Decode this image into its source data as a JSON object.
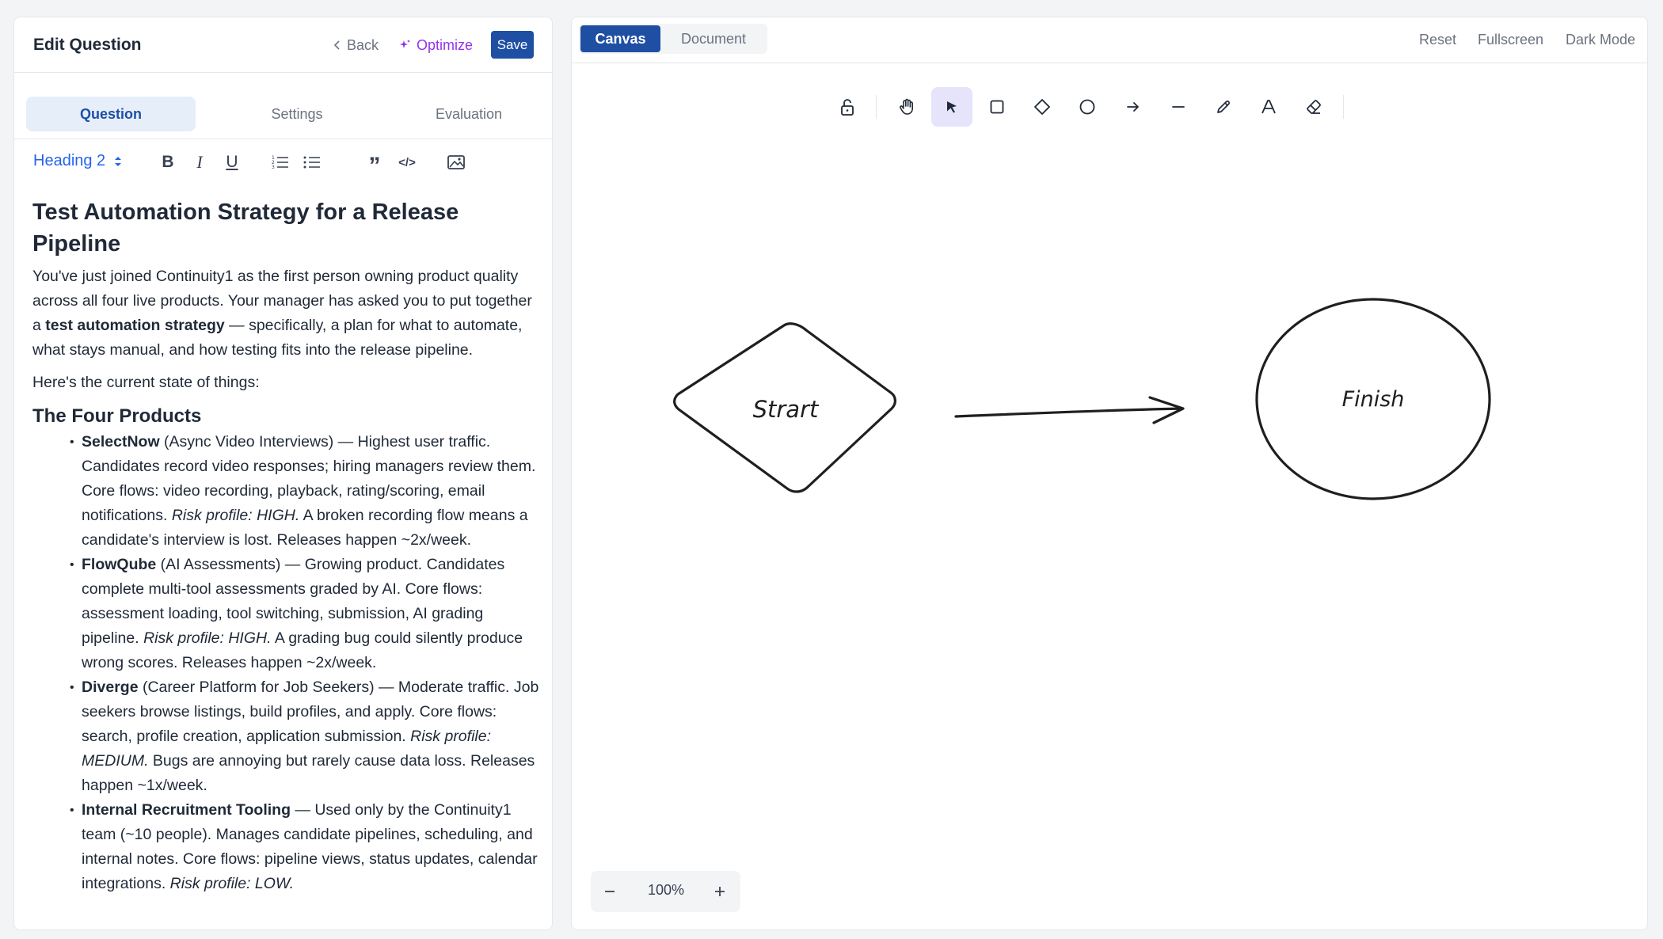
{
  "header": {
    "title": "Edit Question",
    "back_label": "Back",
    "optimize_label": "Optimize",
    "save_label": "Save"
  },
  "tabs": [
    {
      "label": "Question",
      "active": true
    },
    {
      "label": "Settings",
      "active": false
    },
    {
      "label": "Evaluation",
      "active": false
    }
  ],
  "editor_toolbar": {
    "heading_select": "Heading 2",
    "buttons": [
      "bold-icon",
      "italic-icon",
      "underline-icon",
      "ordered-list-icon",
      "bullet-list-icon",
      "quote-icon",
      "code-icon",
      "image-icon"
    ]
  },
  "content": {
    "title": "Test Automation Strategy for a Release Pipeline",
    "intro_1": "You've just joined Continuity1 as the first person owning product quality across all four live products. Your manager has asked you to put together a ",
    "intro_bold": "test automation strategy",
    "intro_2": " — specifically, a plan for what to automate, what stays manual, and how testing fits into the release pipeline.",
    "state": "Here's the current state of things:",
    "section_title": "The Four Products",
    "products": [
      {
        "name": "SelectNow",
        "desc": " (Async Video Interviews) — Highest user traffic. Candidates record video responses; hiring managers review them. Core flows: video recording, playback, rating/scoring, email notifications. ",
        "risk": "Risk profile: HIGH.",
        "tail": " A broken recording flow means a candidate's interview is lost. Releases happen ~2x/week."
      },
      {
        "name": "FlowQube",
        "desc": " (AI Assessments) — Growing product. Candidates complete multi-tool assessments graded by AI. Core flows: assessment loading, tool switching, submission, AI grading pipeline. ",
        "risk": "Risk profile: HIGH.",
        "tail": " A grading bug could silently produce wrong scores. Releases happen ~2x/week."
      },
      {
        "name": "Diverge",
        "desc": " (Career Platform for Job Seekers) — Moderate traffic. Job seekers browse listings, build profiles, and apply. Core flows: search, profile creation, application submission. ",
        "risk": "Risk profile: MEDIUM.",
        "tail": " Bugs are annoying but rarely cause data loss. Releases happen ~1x/week."
      },
      {
        "name": "Internal Recruitment Tooling",
        "desc": " — Used only by the Continuity1 team (~10 people). Manages candidate pipelines, scheduling, and internal notes. Core flows: pipeline views, status updates, calendar integrations. ",
        "risk": "Risk profile: LOW.",
        "tail": ""
      }
    ]
  },
  "canvas_header": {
    "mode_tabs": [
      {
        "label": "Canvas",
        "active": true
      },
      {
        "label": "Document",
        "active": false
      }
    ],
    "reset_label": "Reset",
    "fullscreen_label": "Fullscreen",
    "darkmode_label": "Dark Mode"
  },
  "drawing_tools": [
    "lock-icon",
    "hand-icon",
    "pointer-icon",
    "rectangle-icon",
    "diamond-icon",
    "circle-icon",
    "arrow-icon",
    "line-icon",
    "pencil-icon",
    "text-icon",
    "eraser-icon"
  ],
  "active_tool": "pointer-icon",
  "canvas": {
    "shapes": [
      {
        "type": "diamond",
        "label": "Strart"
      },
      {
        "type": "arrow",
        "label": ""
      },
      {
        "type": "ellipse",
        "label": "Finish"
      }
    ]
  },
  "zoom": {
    "value": "100%"
  },
  "colors": {
    "accent": "#1e4fa3",
    "optimize": "#9333ea",
    "active_tool_bg": "#e6e4fb"
  }
}
